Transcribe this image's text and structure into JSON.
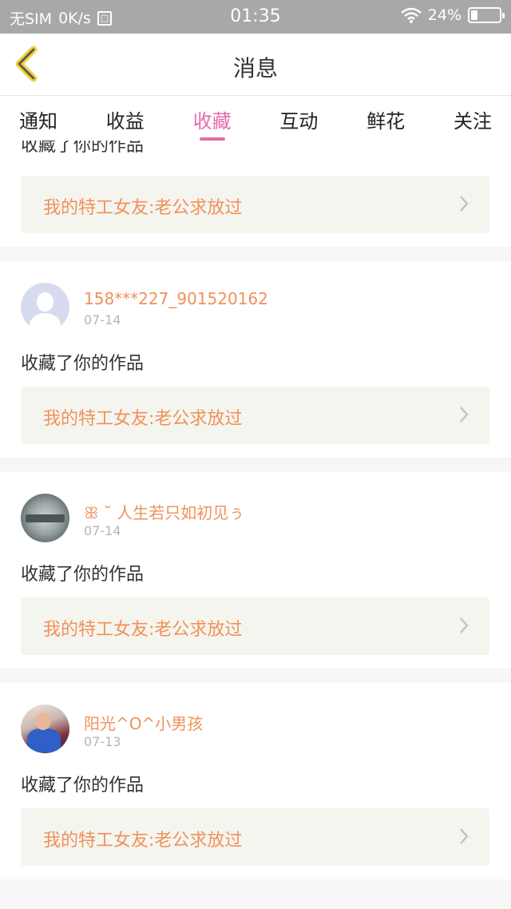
{
  "status_bar": {
    "carrier": "无SIM",
    "speed": "0K/s",
    "time": "01:35",
    "battery": "24%",
    "battery_level": 0.24
  },
  "nav": {
    "title": "消息",
    "back_icon": "chevron-left-icon"
  },
  "tabs": [
    {
      "label": "通知"
    },
    {
      "label": "收益"
    },
    {
      "label": "收藏",
      "active": true
    },
    {
      "label": "互动"
    },
    {
      "label": "鲜花"
    },
    {
      "label": "关注"
    }
  ],
  "items": [
    {
      "message": "收藏了你的作品",
      "work_title": "我的特工女友:老公求放过"
    },
    {
      "username": "158***227_901520162",
      "date": "07-14",
      "message": "收藏了你的作品",
      "work_title": "我的特工女友:老公求放过",
      "avatar": "default-avatar"
    },
    {
      "username": "ꕥ ˘ 人生若只如初见ぅ",
      "date": "07-14",
      "message": "收藏了你的作品",
      "work_title": "我的特工女友:老公求放过",
      "avatar": "coin-avatar"
    },
    {
      "username": "阳光^O^小男孩",
      "date": "07-13",
      "message": "收藏了你的作品",
      "work_title": "我的特工女友:老公求放过",
      "avatar": "photo-avatar"
    }
  ],
  "colors": {
    "accent": "#e66aa8",
    "username": "#f0915a",
    "status_bar": "#a8a8a8"
  }
}
